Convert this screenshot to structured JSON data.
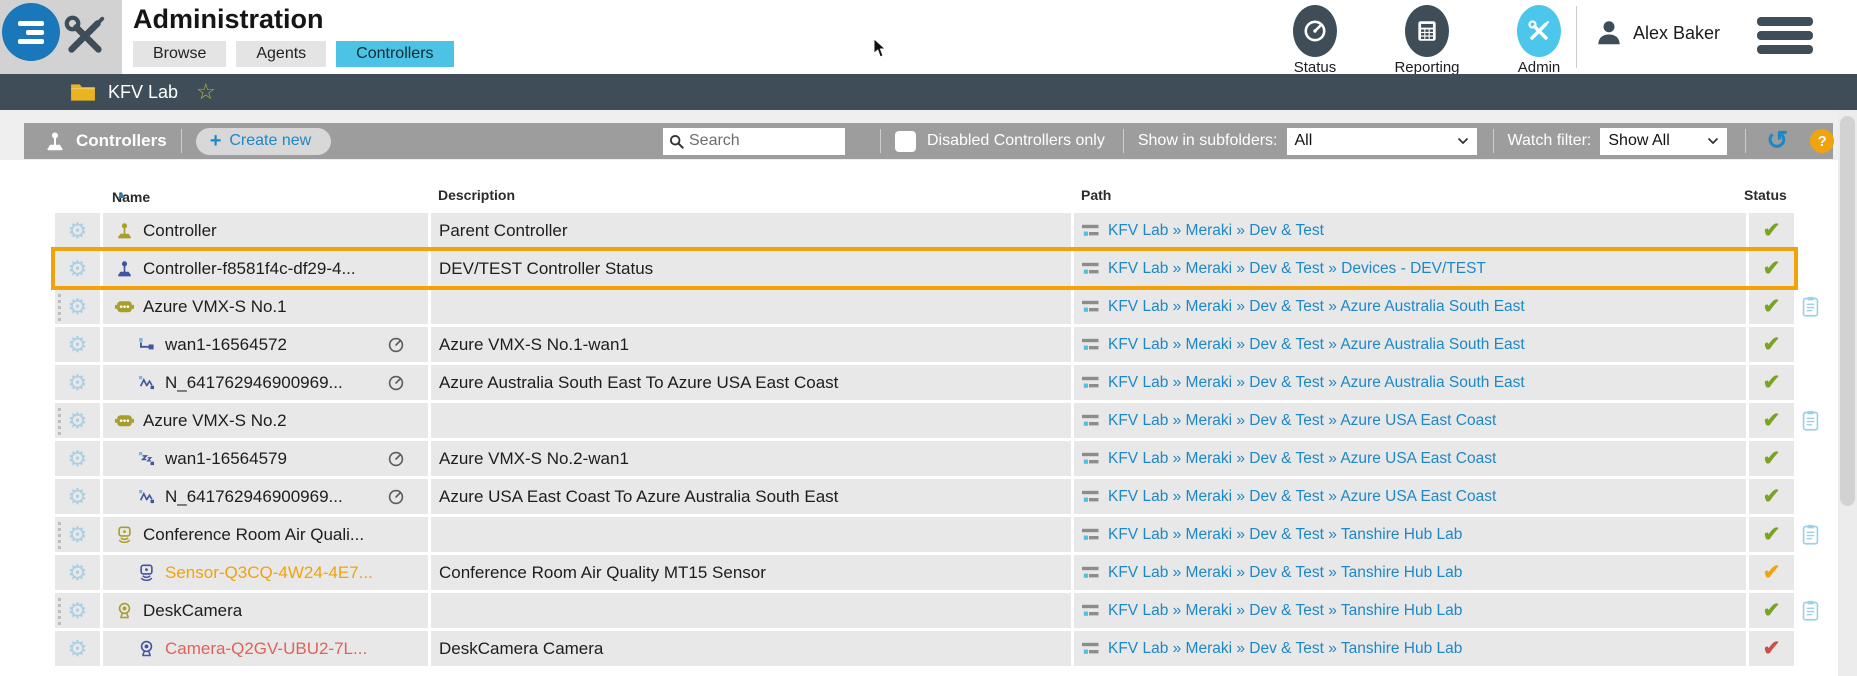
{
  "header": {
    "title": "Administration",
    "tabs": [
      {
        "label": "Browse",
        "active": false
      },
      {
        "label": "Agents",
        "active": false
      },
      {
        "label": "Controllers",
        "active": true
      }
    ],
    "nav": [
      {
        "label": "Status",
        "icon": "gauge-icon"
      },
      {
        "label": "Reporting",
        "icon": "report-grid-icon"
      },
      {
        "label": "Admin",
        "icon": "tools-icon"
      }
    ],
    "user_name": "Alex Baker"
  },
  "location_bar": {
    "name": "KFV Lab",
    "star_icon": "☆"
  },
  "toolbar": {
    "section_title": "Controllers",
    "create_label": "Create new",
    "plus_glyph": "+",
    "search_placeholder": "Search",
    "checkbox_label": "Disabled Controllers only",
    "subfolders_label": "Show in subfolders:",
    "subfolders_value": "All",
    "watch_label": "Watch filter:",
    "watch_value": "Show All",
    "refresh_glyph": "↺",
    "help_glyph": "?"
  },
  "table": {
    "columns": {
      "name": "Name",
      "description": "Description",
      "path": "Path",
      "status": "Status"
    },
    "sort_glyph": "▲",
    "rows": [
      {
        "name": "Controller",
        "icon": "joystick",
        "icon_color": "olive",
        "child": false,
        "gauge": false,
        "description": "Parent Controller",
        "path": "KFV Lab » Meraki » Dev & Test",
        "status": "green",
        "clipboard": false,
        "handle": false,
        "highlighted": false,
        "name_color": ""
      },
      {
        "name": "Controller-f8581f4c-df29-4...",
        "icon": "joystick",
        "icon_color": "blue",
        "child": false,
        "gauge": false,
        "description": "DEV/TEST Controller Status",
        "path": "KFV Lab » Meraki » Dev & Test » Devices - DEV/TEST",
        "status": "green",
        "clipboard": false,
        "handle": false,
        "highlighted": true,
        "name_color": ""
      },
      {
        "name": "Azure VMX-S No.1",
        "icon": "robot",
        "icon_color": "olive",
        "child": false,
        "gauge": false,
        "description": "",
        "path": "KFV Lab » Meraki » Dev & Test » Azure Australia South East",
        "status": "green",
        "clipboard": true,
        "handle": true,
        "highlighted": false,
        "name_color": ""
      },
      {
        "name": "wan1-16564572",
        "icon": "wan-link",
        "icon_color": "blue",
        "child": true,
        "gauge": true,
        "description": "Azure VMX-S No.1-wan1",
        "path": "KFV Lab » Meraki » Dev & Test » Azure Australia South East",
        "status": "green",
        "clipboard": false,
        "handle": false,
        "highlighted": false,
        "name_color": ""
      },
      {
        "name": "N_641762946900969...",
        "icon": "tunnel-wave",
        "icon_color": "blue",
        "child": true,
        "gauge": true,
        "description": "Azure Australia South East To Azure USA East Coast",
        "path": "KFV Lab » Meraki » Dev & Test » Azure Australia South East",
        "status": "green",
        "clipboard": false,
        "handle": false,
        "highlighted": false,
        "name_color": ""
      },
      {
        "name": "Azure VMX-S No.2",
        "icon": "robot",
        "icon_color": "olive",
        "child": false,
        "gauge": false,
        "description": "",
        "path": "KFV Lab » Meraki » Dev & Test » Azure USA East Coast",
        "status": "green",
        "clipboard": true,
        "handle": true,
        "highlighted": false,
        "name_color": ""
      },
      {
        "name": "wan1-16564579",
        "icon": "wan-sleep",
        "icon_color": "blue",
        "child": true,
        "gauge": true,
        "description": "Azure VMX-S No.2-wan1",
        "path": "KFV Lab » Meraki » Dev & Test » Azure USA East Coast",
        "status": "green",
        "clipboard": false,
        "handle": false,
        "highlighted": false,
        "name_color": ""
      },
      {
        "name": "N_641762946900969...",
        "icon": "tunnel-wave",
        "icon_color": "blue",
        "child": true,
        "gauge": true,
        "description": "Azure USA East Coast To Azure Australia South East",
        "path": "KFV Lab » Meraki » Dev & Test » Azure USA East Coast",
        "status": "green",
        "clipboard": false,
        "handle": false,
        "highlighted": false,
        "name_color": ""
      },
      {
        "name": "Conference Room Air Quali...",
        "icon": "sensor",
        "icon_color": "olive",
        "child": false,
        "gauge": false,
        "description": "",
        "path": "KFV Lab » Meraki » Dev & Test » Tanshire Hub Lab",
        "status": "green",
        "clipboard": true,
        "handle": true,
        "highlighted": false,
        "name_color": ""
      },
      {
        "name": "Sensor-Q3CQ-4W24-4E7...",
        "icon": "sensor",
        "icon_color": "blue",
        "child": true,
        "gauge": false,
        "description": "Conference Room Air Quality MT15 Sensor",
        "path": "KFV Lab » Meraki » Dev & Test » Tanshire Hub Lab",
        "status": "orange",
        "clipboard": false,
        "handle": false,
        "highlighted": false,
        "name_color": "orange"
      },
      {
        "name": "DeskCamera",
        "icon": "camera",
        "icon_color": "olive",
        "child": false,
        "gauge": false,
        "description": "",
        "path": "KFV Lab » Meraki » Dev & Test » Tanshire Hub Lab",
        "status": "green",
        "clipboard": true,
        "handle": true,
        "highlighted": false,
        "name_color": ""
      },
      {
        "name": "Camera-Q2GV-UBU2-7L...",
        "icon": "camera",
        "icon_color": "blue",
        "child": true,
        "gauge": false,
        "description": "DeskCamera Camera",
        "path": "KFV Lab » Meraki » Dev & Test » Tanshire Hub Lab",
        "status": "red",
        "clipboard": false,
        "handle": false,
        "highlighted": false,
        "name_color": "red"
      }
    ]
  },
  "colors": {
    "accent_cyan": "#4cc2e4",
    "dark_slate": "#3e4d57",
    "link_blue": "#1e88c7",
    "highlight_orange": "#f0a30c",
    "status_green": "#7aa225",
    "status_orange": "#f2a20d",
    "status_red": "#c8504a",
    "icon_olive": "#a89e2b",
    "icon_blue": "#42549e"
  }
}
